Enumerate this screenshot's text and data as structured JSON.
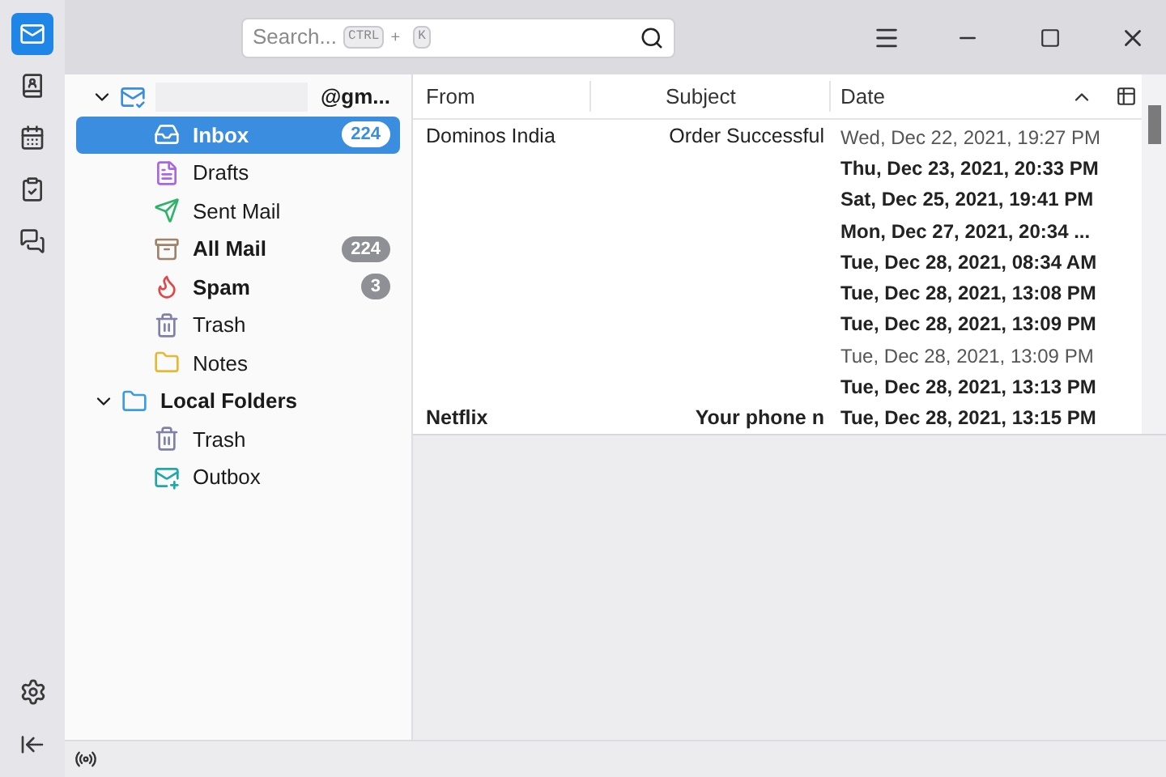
{
  "search": {
    "placeholder": "Search...",
    "shortcut": [
      "CTRL",
      "+",
      "K"
    ]
  },
  "rail": [
    {
      "kind": "mail",
      "selected": true
    },
    {
      "kind": "contacts",
      "selected": false
    },
    {
      "kind": "calendar",
      "selected": false
    },
    {
      "kind": "tasks",
      "selected": false
    },
    {
      "kind": "chat",
      "selected": false
    }
  ],
  "folders": [
    {
      "name": "@gm...",
      "kind": "account",
      "expanded": true,
      "bold": true,
      "redacted": true,
      "children": [
        {
          "name": "Inbox",
          "kind": "inbox",
          "count": "224",
          "bold": true,
          "selected": true
        },
        {
          "name": "Drafts",
          "kind": "drafts",
          "bold": false,
          "selected": false
        },
        {
          "name": "Sent Mail",
          "kind": "sent",
          "bold": false,
          "selected": false
        },
        {
          "name": "All Mail",
          "kind": "archive",
          "count": "224",
          "bold": true,
          "selected": false
        },
        {
          "name": "Spam",
          "kind": "spam",
          "count": "3",
          "bold": true,
          "selected": false
        },
        {
          "name": "Trash",
          "kind": "trash",
          "bold": false,
          "selected": false
        },
        {
          "name": "Notes",
          "kind": "folder",
          "bold": false,
          "selected": false
        }
      ]
    },
    {
      "name": "Local Folders",
      "kind": "localfolder",
      "expanded": true,
      "bold": true,
      "children": [
        {
          "name": "Trash",
          "kind": "trash",
          "bold": false,
          "selected": false
        },
        {
          "name": "Outbox",
          "kind": "outbox",
          "bold": false,
          "selected": false
        }
      ]
    }
  ],
  "table": {
    "columns": [
      "From",
      "Subject",
      "Date"
    ],
    "rows": [
      {
        "from": "Dominos India",
        "subject": "Order Successful",
        "date": "Wed, Dec 22, 2021, 19:27 PM",
        "unread": false
      },
      {
        "date": "Thu, Dec 23, 2021, 20:33 PM",
        "unread": true
      },
      {
        "date": "Sat, Dec 25, 2021, 19:41 PM",
        "unread": true
      },
      {
        "date": "Mon, Dec 27, 2021, 20:34 ...",
        "unread": true
      },
      {
        "date": "Tue, Dec 28, 2021, 08:34 AM",
        "unread": true
      },
      {
        "date": "Tue, Dec 28, 2021, 13:08 PM",
        "unread": true
      },
      {
        "date": "Tue, Dec 28, 2021, 13:09 PM",
        "unread": true
      },
      {
        "date": "Tue, Dec 28, 2021, 13:09 PM",
        "unread": false
      },
      {
        "date": "Tue, Dec 28, 2021, 13:13 PM",
        "unread": true
      },
      {
        "from": "Netflix",
        "subject": "Your phone n",
        "date": "Tue, Dec 28, 2021, 13:15 PM",
        "unread": true
      }
    ]
  }
}
